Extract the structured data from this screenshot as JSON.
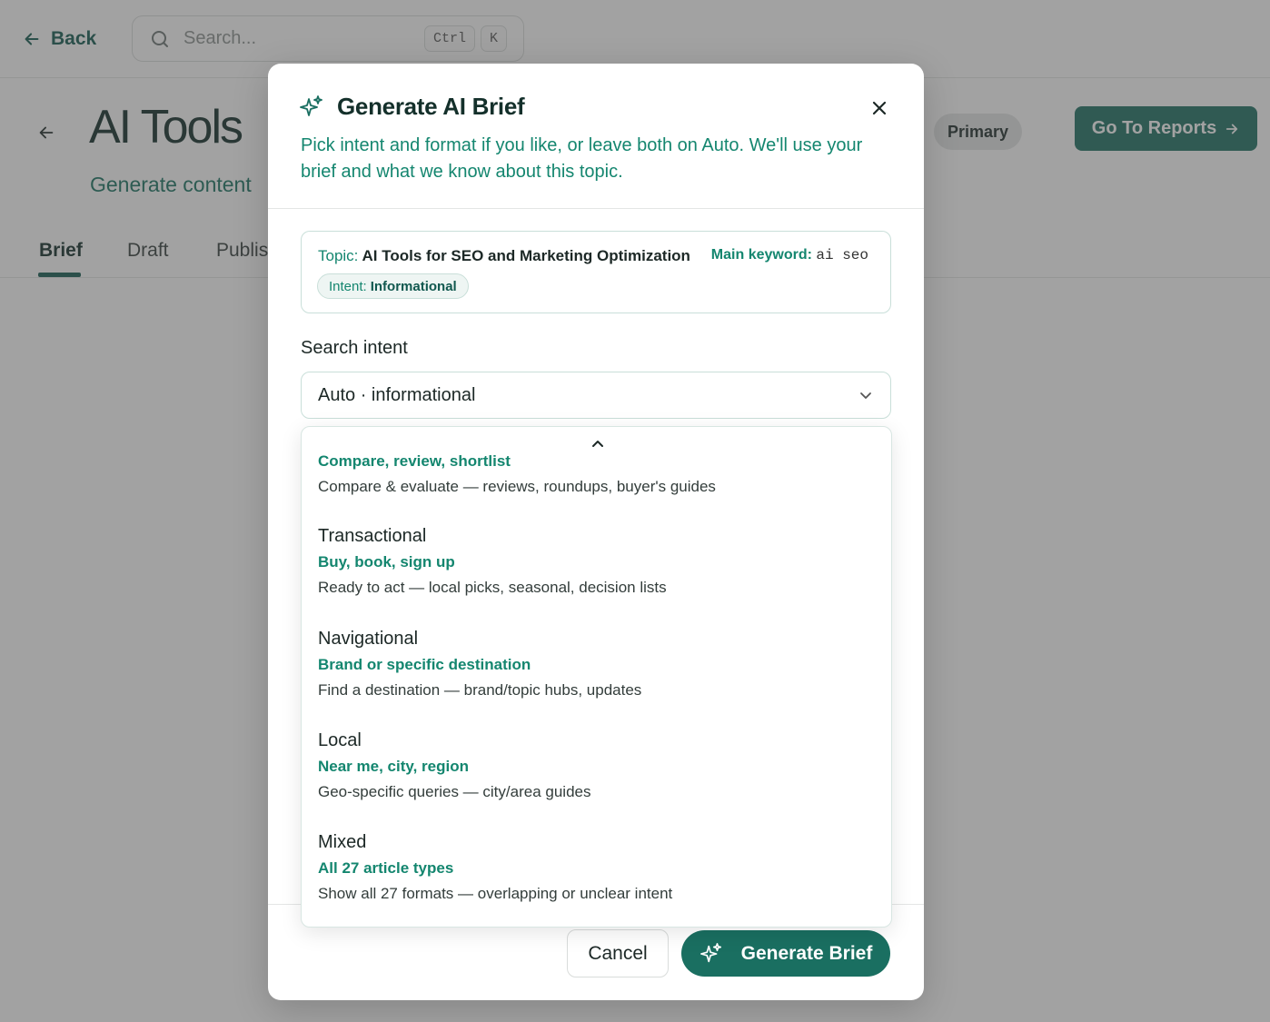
{
  "topbar": {
    "back_label": "Back",
    "search_placeholder": "Search...",
    "shortcut_keys": [
      "Ctrl",
      "K"
    ]
  },
  "page": {
    "title": "AI Tools",
    "subtitle": "Generate content",
    "badge": "Primary",
    "reports_button": "Go To Reports",
    "tabs": [
      "Brief",
      "Draft",
      "Publis"
    ]
  },
  "modal": {
    "title": "Generate AI Brief",
    "description": "Pick intent and format if you like, or leave both on Auto. We'll use your brief and what we know about this topic.",
    "topic_label": "Topic:",
    "topic_value": "AI Tools for SEO and Marketing Optimization",
    "keyword_label": "Main keyword:",
    "keyword_value": "ai seo",
    "intent_label": "Intent:",
    "intent_value": "Informational",
    "search_intent_label": "Search intent",
    "search_intent_value": "Auto · informational",
    "cancel_label": "Cancel",
    "generate_label": "Generate Brief"
  },
  "dropdown": {
    "partial_option": {
      "subtitle": "Compare, review, shortlist",
      "description": "Compare & evaluate — reviews, roundups, buyer's guides"
    },
    "options": [
      {
        "title": "Transactional",
        "subtitle": "Buy, book, sign up",
        "description": "Ready to act — local picks, seasonal, decision lists"
      },
      {
        "title": "Navigational",
        "subtitle": "Brand or specific destination",
        "description": "Find a destination — brand/topic hubs, updates"
      },
      {
        "title": "Local",
        "subtitle": "Near me, city, region",
        "description": "Geo-specific queries — city/area guides"
      },
      {
        "title": "Mixed",
        "subtitle": "All 27 article types",
        "description": "Show all 27 formats — overlapping or unclear intent"
      }
    ]
  },
  "colors": {
    "brand": "#1a6f61",
    "accent_text": "#14866f",
    "overlay": "rgba(70,70,70,0.5)"
  }
}
